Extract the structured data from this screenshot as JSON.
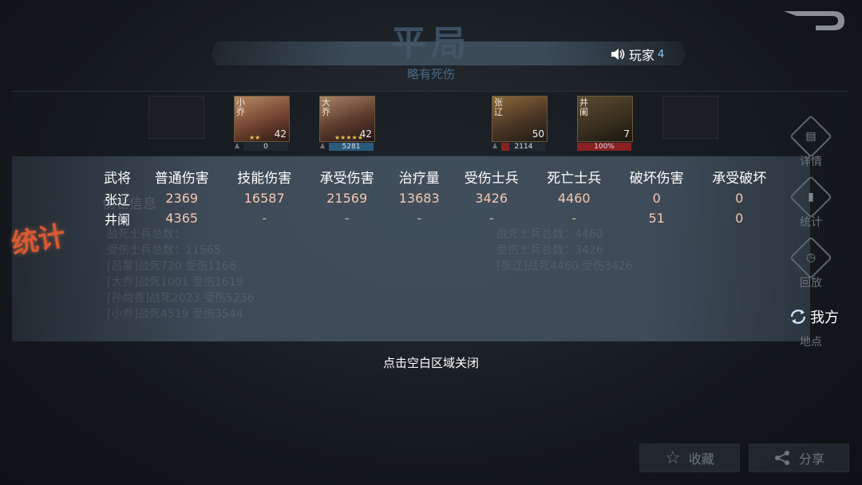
{
  "header": {
    "result_title": "平局",
    "result_subtitle": "略有死伤",
    "player_label": "玩家",
    "player_suffix": "4"
  },
  "heroes_left": [
    {
      "name": "小乔",
      "level": "42",
      "stars": "★★",
      "bar_value": "0"
    },
    {
      "name": "大乔",
      "level": "42",
      "stars": "★★★★★",
      "bar_value": "5281"
    }
  ],
  "heroes_right": [
    {
      "name": "张辽",
      "level": "50",
      "bar_value": "2114"
    },
    {
      "name": "井阑",
      "level": "7",
      "bar_value": "100%"
    }
  ],
  "stats": {
    "headers": [
      "武将",
      "普通伤害",
      "技能伤害",
      "承受伤害",
      "治疗量",
      "受伤士兵",
      "死亡士兵",
      "破坏伤害",
      "承受破坏"
    ],
    "rows": [
      [
        "张辽",
        "2369",
        "16587",
        "21569",
        "13683",
        "3426",
        "4460",
        "0",
        "0"
      ],
      [
        "井阑",
        "4365",
        "-",
        "-",
        "-",
        "-",
        "-",
        "51",
        "0"
      ]
    ],
    "stamp": "统计"
  },
  "background_log": {
    "title": "伤亡信息",
    "left_lines": [
      "战死士兵总数：",
      "受伤士兵总数：11565",
      "[吕蒙]战死720 受伤1166",
      "[大乔]战死1001 受伤1619",
      "[孙尚香]战死2023 受伤5236",
      "[小乔]战死4519 受伤3544"
    ],
    "right_lines": [
      "战死士兵总数：4460",
      "受伤士兵总数：3426",
      "[张辽]战死4460 受伤3426"
    ]
  },
  "right_menu": {
    "details": "详情",
    "stats": "统计",
    "replay": "回放",
    "our_side": "我方",
    "location": "地点"
  },
  "close_hint": "点击空白区域关闭",
  "bottom": {
    "favorite": "收藏",
    "share": "分享"
  }
}
